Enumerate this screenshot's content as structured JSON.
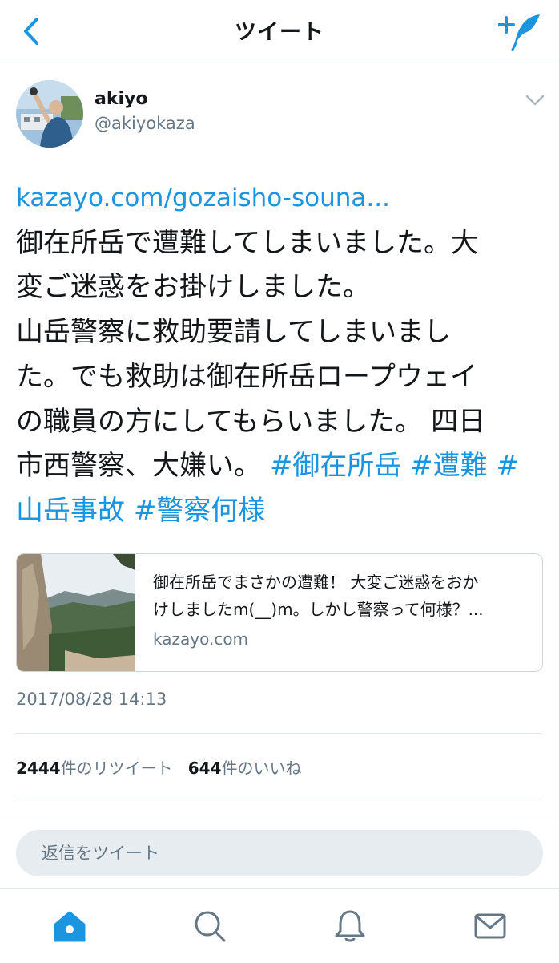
{
  "header": {
    "title": "ツイート"
  },
  "author": {
    "name": "akiyo",
    "handle": "@akiyokaza"
  },
  "tweet": {
    "link": "kazayo.com/gozaisho-souna...",
    "line1": "御在所岳で遭難してしまいました。大",
    "line2": "変ご迷惑をお掛けしました。",
    "line3": "山岳警察に救助要請してしまいまし",
    "line4": "た。でも救助は御在所岳ロープウェイ",
    "line5": "の職員の方にしてもらいました。 四日",
    "line6_text": "市西警察、大嫌い。",
    "tag1": "#御在所岳",
    "tag2": "#遭難",
    "tag3_a": "#",
    "tag3_b": "山岳事故",
    "tag4": "#警察何様"
  },
  "card": {
    "desc_line1": "御在所岳でまさかの遭難！ 大変ご迷惑をおか",
    "desc_line2": "けしましたm(__)m。しかし警察って何様？...",
    "domain": "kazayo.com"
  },
  "timestamp": "2017/08/28 14:13",
  "stats": {
    "retweets_count": "2444",
    "retweets_label": "件のリツイート",
    "likes_count": "644",
    "likes_label": "件のいいね"
  },
  "reply": {
    "placeholder": "返信をツイート"
  },
  "tabs": [
    "home-icon",
    "search-icon",
    "notifications-icon",
    "messages-icon"
  ],
  "colors": {
    "accent": "#1b95e0",
    "text": "#14171a",
    "secondary": "#657786",
    "border": "#e1e8ed"
  }
}
